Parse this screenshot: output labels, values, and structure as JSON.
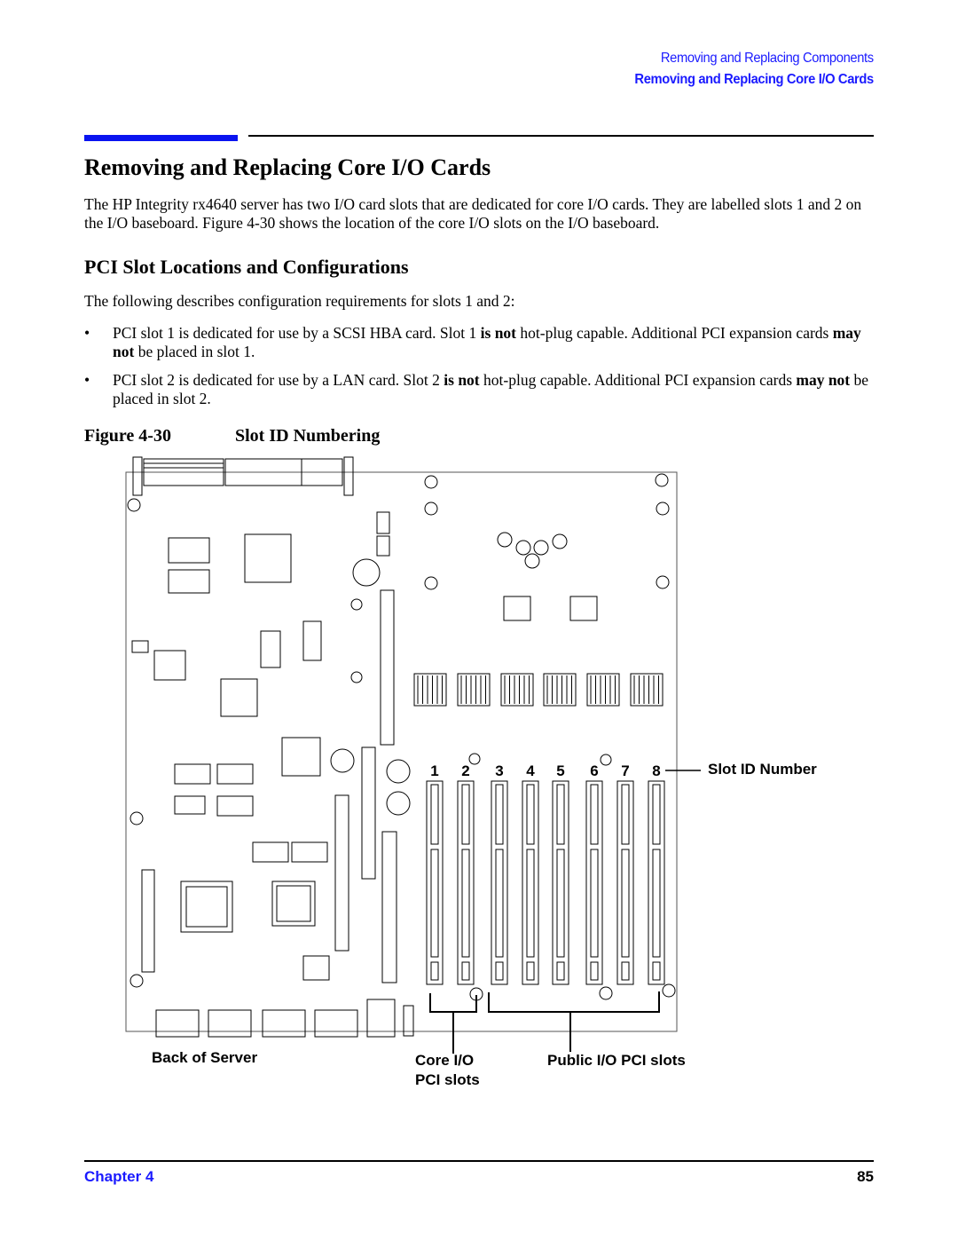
{
  "header": {
    "section": "Removing and Replacing Components",
    "subsection": "Removing and Replacing Core I/O Cards"
  },
  "title": "Removing and Replacing Core I/O Cards",
  "intro": "The HP Integrity rx4640 server has two I/O card slots that are dedicated for core I/O cards. They are labelled slots 1 and 2 on the I/O baseboard. Figure 4-30 shows the location of the core I/O slots on the I/O baseboard.",
  "subheading": "PCI Slot Locations and Configurations",
  "lead": "The following describes configuration requirements for slots 1 and 2:",
  "bullets": [
    {
      "a": "PCI slot 1 is dedicated for use by a SCSI HBA card. Slot 1 ",
      "b1": "is not",
      "c": " hot-plug capable. Additional PCI expansion cards ",
      "b2": "may not",
      "d": " be placed in slot 1."
    },
    {
      "a": "PCI slot 2 is dedicated for use by a LAN card. Slot 2 ",
      "b1": "is not",
      "c": " hot-plug capable. Additional PCI expansion cards ",
      "b2": "may not",
      "d": " be placed in slot 2."
    }
  ],
  "bullet_symbol": "•",
  "figure": {
    "number": "Figure 4-30",
    "title": "Slot ID Numbering",
    "slot_numbers": [
      "1",
      "2",
      "3",
      "4",
      "5",
      "6",
      "7",
      "8"
    ],
    "labels": {
      "slot_id": "Slot ID Number",
      "back": "Back of Server",
      "core_1": "Core I/O",
      "core_2": "PCI slots",
      "public": "Public I/O PCI slots"
    }
  },
  "footer": {
    "chapter": "Chapter 4",
    "page": "85"
  },
  "colors": {
    "accent": "#1a1aff"
  }
}
